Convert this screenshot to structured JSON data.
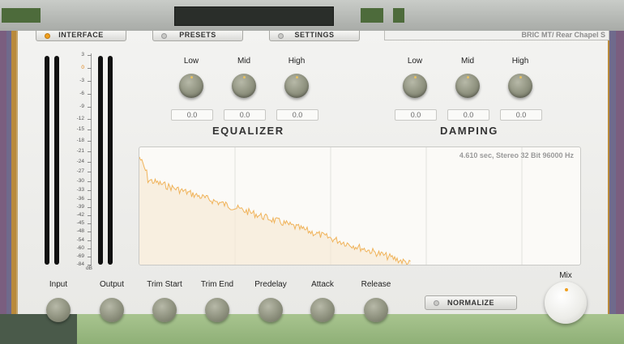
{
  "top_buttons": {
    "interface": "INTERFACE",
    "presets": "PRESETS",
    "settings": "SETTINGS"
  },
  "impulse_name": "BRIC MT/ Rear Chapel S",
  "meter_scale": {
    "ticks": [
      "3",
      "0",
      "-3",
      "-6",
      "-9",
      "-12",
      "-15",
      "-18",
      "-21",
      "-24",
      "-27",
      "-30",
      "-33",
      "-36",
      "-39",
      "-42",
      "-45",
      "-48",
      "-54",
      "-60",
      "-69",
      "-84"
    ],
    "unit": "dB"
  },
  "equalizer": {
    "title": "EQUALIZER",
    "bands": [
      {
        "label": "Low",
        "value": "0.0"
      },
      {
        "label": "Mid",
        "value": "0.0"
      },
      {
        "label": "High",
        "value": "0.0"
      }
    ]
  },
  "damping": {
    "title": "DAMPING",
    "bands": [
      {
        "label": "Low",
        "value": "0.0"
      },
      {
        "label": "Mid",
        "value": "0.0"
      },
      {
        "label": "High",
        "value": "0.0"
      }
    ]
  },
  "ir_info": "4.610 sec, Stereo 32 Bit 96000 Hz",
  "bottom_controls": {
    "input": "Input",
    "output": "Output",
    "trim_start": "Trim Start",
    "trim_end": "Trim End",
    "predelay": "Predelay",
    "attack": "Attack",
    "release": "Release",
    "normalize": "NORMALIZE",
    "mix": "Mix"
  },
  "colors": {
    "accent": "#f0a020",
    "waveform": "#f0b35a"
  }
}
